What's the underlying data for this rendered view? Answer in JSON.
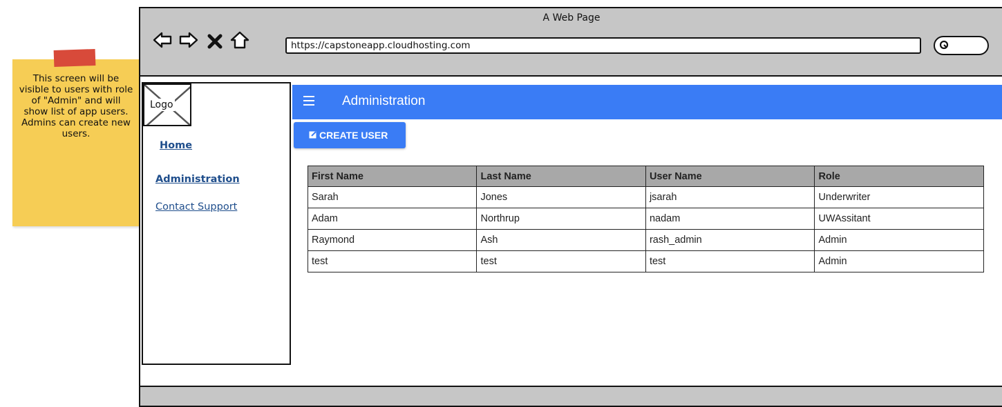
{
  "note": {
    "text": "This screen will be visible to users with role of \"Admin\" and will show list of app users. Admins can create new users.",
    "color": "#f6cd55",
    "tape_color": "#d84a3a"
  },
  "browser": {
    "title": "A Web Page",
    "url": "https://capstoneapp.cloudhosting.com",
    "nav_icons": [
      "back-arrow-icon",
      "forward-arrow-icon",
      "close-x-icon",
      "home-icon"
    ],
    "search_icon": "search-icon"
  },
  "sidebar": {
    "logo_label": "Logo",
    "items": [
      {
        "label": "Home"
      },
      {
        "label": "Administration"
      },
      {
        "label": "Contact Support"
      }
    ]
  },
  "header": {
    "title": "Administration",
    "menu_icon": "hamburger-menu-icon",
    "color": "#3a7cf5"
  },
  "toolbar": {
    "create_label": "CREATE USER",
    "create_icon": "edit-square-icon"
  },
  "table": {
    "columns": [
      "First Name",
      "Last Name",
      "User Name",
      "Role"
    ],
    "rows": [
      [
        "Sarah",
        "Jones",
        "jsarah",
        "Underwriter"
      ],
      [
        "Adam",
        "Northrup",
        "nadam",
        "UWAssitant"
      ],
      [
        "Raymond",
        "Ash",
        "rash_admin",
        "Admin"
      ],
      [
        "test",
        "test",
        "test",
        "Admin"
      ]
    ]
  }
}
